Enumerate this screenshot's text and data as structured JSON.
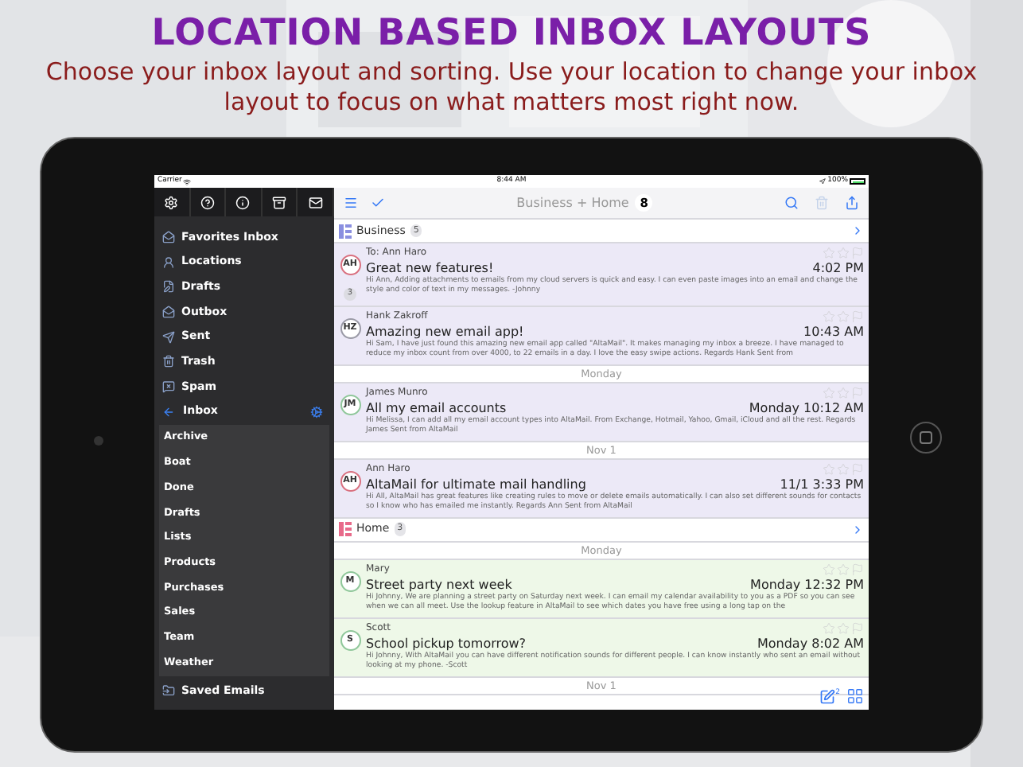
{
  "header": {
    "title": "LOCATION BASED INBOX LAYOUTS",
    "subtitle": "Choose your inbox layout and sorting. Use your location to change your inbox layout to focus on what matters most right now."
  },
  "status_bar": {
    "carrier": "Carrier",
    "time": "8:44 AM",
    "battery": "100%"
  },
  "sidebar": {
    "folders": [
      "Favorites Inbox",
      "Locations",
      "Drafts",
      "Outbox",
      "Sent",
      "Trash",
      "Spam"
    ],
    "inbox": "Inbox",
    "subfolders": [
      "Archive",
      "Boat",
      "Done",
      "Drafts",
      "Lists",
      "Products",
      "Purchases",
      "Sales",
      "Team",
      "Weather"
    ],
    "saved": "Saved Emails"
  },
  "toolbar": {
    "title": "Business + Home",
    "count": "8"
  },
  "groups": [
    {
      "name": "Business",
      "count": "5",
      "icon": {
        "color": "#8a8fe0"
      },
      "color": "#ece9f7",
      "items": [
        {
          "kind": "mail",
          "initials": "AH",
          "color": "#d9707f",
          "from": "To: Ann Haro",
          "subject": "Great new features!",
          "time": "4:02 PM",
          "thread": "3",
          "preview": "Hi Ann, Adding attachments to emails from my cloud servers is quick and easy. I can even paste images into an email and change the style and color of text in my messages. -Johnny"
        },
        {
          "kind": "mail",
          "initials": "HZ",
          "color": "#9a9aa6",
          "from": "Hank Zakroff",
          "subject": "Amazing new email app!",
          "time": "10:43 AM",
          "preview": "Hi Sam, I have just found this amazing new email app called \"AltaMail\". It makes managing my inbox a breeze. I have managed to reduce my inbox count from over 4000, to 22 emails in a day. I love the easy swipe actions. Regards Hank Sent from"
        },
        {
          "kind": "date",
          "label": "Monday"
        },
        {
          "kind": "mail",
          "initials": "JM",
          "color": "#8fc79a",
          "from": "James Munro",
          "subject": "All my email accounts",
          "time": "Monday 10:12 AM",
          "preview": "Hi Melissa, I can add all my email account types into AltaMail. From Exchange, Hotmail, Yahoo, Gmail, iCloud and all the rest. Regards James Sent from AltaMail"
        },
        {
          "kind": "date",
          "label": "Nov 1"
        },
        {
          "kind": "mail",
          "initials": "AH",
          "color": "#d9707f",
          "from": "Ann Haro",
          "subject": "AltaMail for ultimate mail handling",
          "time": "11/1 3:33 PM",
          "preview": "Hi All, AltaMail has great features like creating rules to move or delete emails automatically. I can also set different sounds for contacts so I know who has emailed me instantly. Regards Ann Sent from AltaMail"
        }
      ]
    },
    {
      "name": "Home",
      "count": "3",
      "icon": {
        "color": "#e86a8a"
      },
      "color": "#eef8e8",
      "items": [
        {
          "kind": "date",
          "label": "Monday"
        },
        {
          "kind": "mail",
          "initials": "M",
          "color": "#8fc79a",
          "from": "Mary",
          "subject": "Street party next week",
          "time": "Monday 12:32 PM",
          "preview": "Hi Johnny, We are planning a street party on Saturday next week. I can email my calendar availability to you as a PDF so you can see when we can all meet. Use the lookup feature in AltaMail to see which dates you have free using a long tap on the"
        },
        {
          "kind": "mail",
          "initials": "S",
          "color": "#8fc79a",
          "from": "Scott",
          "subject": "School pickup tomorrow?",
          "time": "Monday 8:02 AM",
          "preview": "Hi Johnny, With AltaMail you can have different notification sounds for different people. I can know instantly who sent an email without looking at my phone. -Scott"
        },
        {
          "kind": "date",
          "label": "Nov 1"
        }
      ]
    }
  ],
  "compose_badge": "2"
}
